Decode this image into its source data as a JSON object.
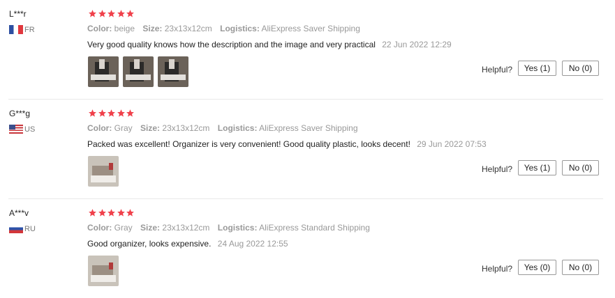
{
  "reviews": [
    {
      "user": "L***r",
      "country": "FR",
      "color_label": "Color:",
      "color": "beige",
      "size_label": "Size:",
      "size": "23x13x12cm",
      "logistics_label": "Logistics:",
      "logistics": "AliExpress Saver Shipping",
      "text": "Very good quality knows how the description and the image and very practical",
      "date": "22 Jun 2022 12:29",
      "rating": 5,
      "helpful_label": "Helpful?",
      "yes": "Yes (1)",
      "no": "No (0)"
    },
    {
      "user": "G***g",
      "country": "US",
      "color_label": "Color:",
      "color": "Gray",
      "size_label": "Size:",
      "size": "23x13x12cm",
      "logistics_label": "Logistics:",
      "logistics": "AliExpress Saver Shipping",
      "text": "Packed was excellent! Organizer is very convenient! Good quality plastic, looks decent!",
      "date": "29 Jun 2022 07:53",
      "rating": 5,
      "helpful_label": "Helpful?",
      "yes": "Yes (1)",
      "no": "No (0)"
    },
    {
      "user": "A***v",
      "country": "RU",
      "color_label": "Color:",
      "color": "Gray",
      "size_label": "Size:",
      "size": "23x13x12cm",
      "logistics_label": "Logistics:",
      "logistics": "AliExpress Standard Shipping",
      "text": "Good organizer, looks expensive.",
      "date": "24 Aug 2022 12:55",
      "rating": 5,
      "helpful_label": "Helpful?",
      "yes": "Yes (0)",
      "no": "No (0)"
    }
  ],
  "colors": {
    "star": "#f0414b",
    "text": "#222222",
    "muted": "#999999"
  },
  "icons": {
    "star": "star-icon",
    "flags": [
      "flag-fr-icon",
      "flag-us-icon",
      "flag-ru-icon"
    ]
  }
}
